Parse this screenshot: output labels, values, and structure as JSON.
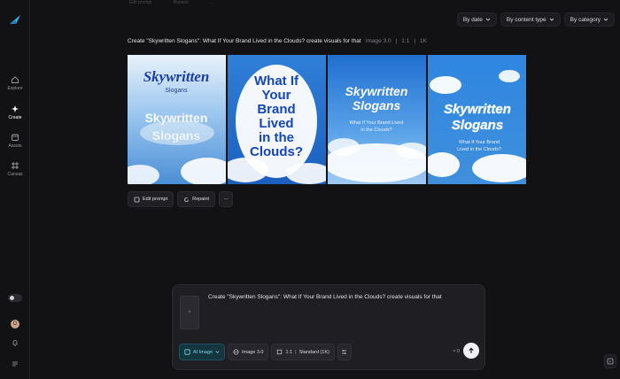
{
  "sidebar": {
    "items": [
      {
        "label": "Explore",
        "icon": "home-icon"
      },
      {
        "label": "Create",
        "icon": "sparkle-icon",
        "active": true
      },
      {
        "label": "Assets",
        "icon": "folder-icon"
      },
      {
        "label": "Canvas",
        "icon": "canvas-icon"
      }
    ],
    "avatar_initial": "D"
  },
  "top_remnant": [
    "Edit prompt",
    "Repaint",
    "..."
  ],
  "filters": [
    {
      "label": "By date"
    },
    {
      "label": "By content type"
    },
    {
      "label": "By category"
    }
  ],
  "prompt": {
    "text": "Create \"Skywritten Slogans\": What If Your Brand Lived in the Clouds? create visuals for that",
    "model": "Image 3.0",
    "ratio": "1:1",
    "resolution": "1K"
  },
  "images": [
    {
      "lines": [
        "Skywritten",
        "Slogans",
        "Skywritten",
        "Slogans"
      ]
    },
    {
      "lines": [
        "What If",
        "Your",
        "Brand",
        "Lived",
        "in the",
        "Clouds?"
      ]
    },
    {
      "lines": [
        "Skywritten",
        "Slogans",
        "What If Your Brand Lived",
        "in the Clouds?"
      ]
    },
    {
      "lines": [
        "Skywritten",
        "Slogans",
        "What If Your Brand",
        "Lived in the Clouds?"
      ]
    }
  ],
  "actions": {
    "edit_prompt": "Edit prompt",
    "repaint": "Repaint",
    "more": "···"
  },
  "composer": {
    "thumb_placeholder": "+",
    "text": "Create \"Skywritten Slogans\": What If Your Brand Lived in the Clouds? create visuals for that",
    "chip_ai_image": "AI Image",
    "chip_model": "Image 3.0",
    "chip_ratio": "1:1",
    "chip_quality": "Standard (1K)",
    "zoom_label": "≈ 0"
  },
  "colors": {
    "background": "#121214",
    "accent": "#7fd4e6",
    "sky": "#3d8be0"
  }
}
